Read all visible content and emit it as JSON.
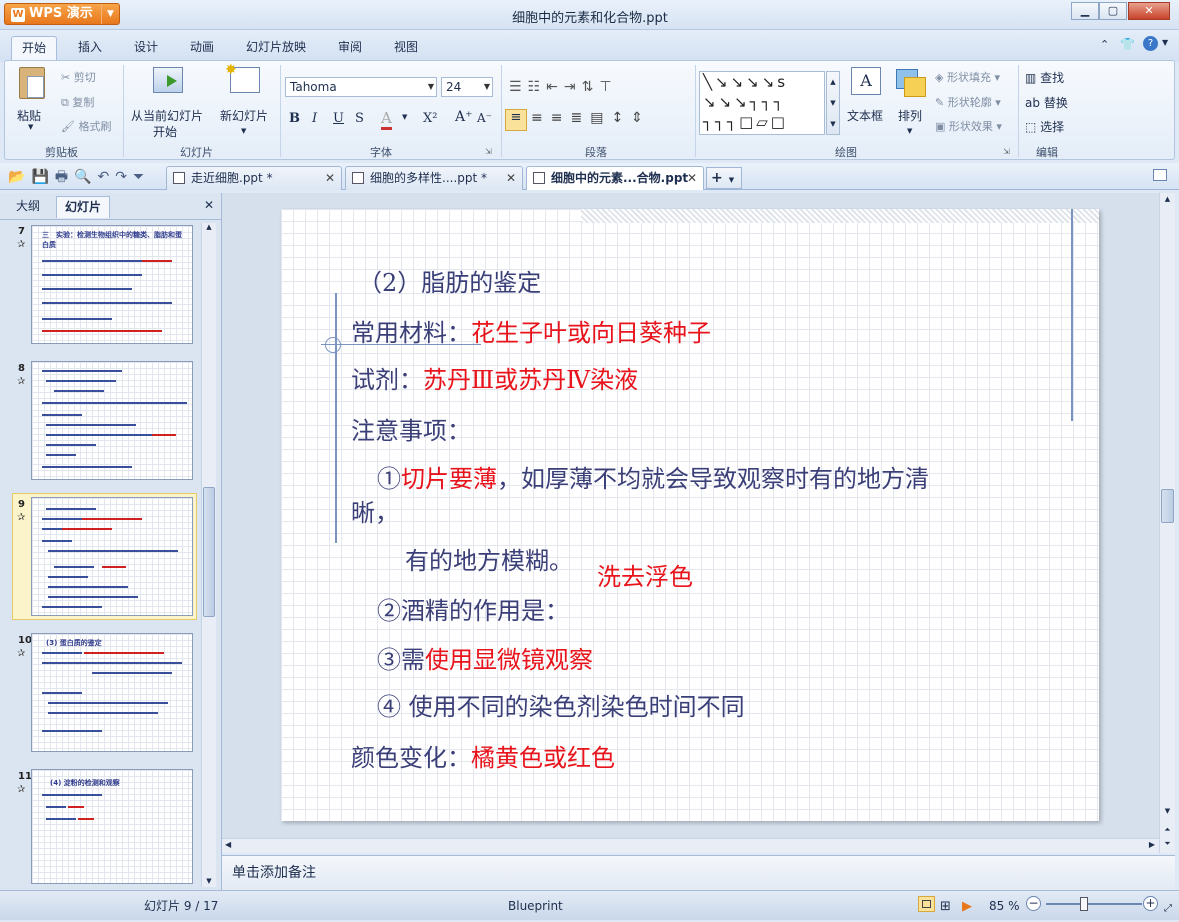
{
  "app": {
    "name": "WPS 演示",
    "window_title": "细胞中的元素和化合物.ppt"
  },
  "menu": {
    "tabs": [
      "开始",
      "插入",
      "设计",
      "动画",
      "幻灯片放映",
      "审阅",
      "视图"
    ],
    "active": "开始"
  },
  "ribbon": {
    "clipboard": {
      "paste": "粘贴",
      "cut": "剪切",
      "copy": "复制",
      "format_painter": "格式刷",
      "label": "剪贴板"
    },
    "slides": {
      "from_current": "从当前幻灯片",
      "start": "开始",
      "new_slide": "新幻灯片",
      "label": "幻灯片"
    },
    "font": {
      "name": "Tahoma",
      "size": "24",
      "label": "字体",
      "bold": "B",
      "italic": "I",
      "underline": "U",
      "shadow": "S",
      "color_a": "A",
      "superscript": "X²",
      "grow": "A⁺",
      "shrink": "A⁻"
    },
    "paragraph": {
      "label": "段落"
    },
    "drawing": {
      "textbox": "文本框",
      "arrange": "排列",
      "shape_fill": "形状填充",
      "shape_outline": "形状轮廓",
      "shape_effect": "形状效果",
      "label": "绘图"
    },
    "editing": {
      "find": "查找",
      "replace": "替换",
      "select": "选择",
      "label": "编辑"
    }
  },
  "doc_tabs": [
    {
      "label": "走近细胞.ppt *",
      "active": false
    },
    {
      "label": "细胞的多样性....ppt *",
      "active": false
    },
    {
      "label": "细胞中的元素...合物.ppt",
      "active": true
    }
  ],
  "left_panel": {
    "tabs": [
      "大纲",
      "幻灯片"
    ],
    "active": "幻灯片",
    "thumb_numbers": [
      "7",
      "8",
      "9",
      "10",
      "11"
    ],
    "selected": "9"
  },
  "slide": {
    "heading": "（2）脂肪的鉴定",
    "material_label": "常用材料：",
    "material_value": "花生子叶或向日葵种子",
    "reagent_label": "试剂：",
    "reagent_value": "苏丹Ⅲ或苏丹Ⅳ染液",
    "notes_title": "注意事项：",
    "item1_prefix": "①",
    "item1_red": "切片要薄",
    "item1_rest": "，如厚薄不均就会导致观察时有的地方清",
    "item1_wrap": "晰，",
    "item1_line2": "有的地方模糊。",
    "item2_answer": "洗去浮色",
    "item2": "②酒精的作用是：",
    "item3_prefix": "③需",
    "item3_red": "使用显微镜观察",
    "item4": "④ 使用不同的染色剂染色时间不同",
    "color_label": "颜色变化：",
    "color_value": "橘黄色或红色"
  },
  "thumbs": {
    "t7_title": "三　实验：检测生物组织中的糖类、脂肪和蛋白质",
    "t10_title": "(3) 蛋白质的鉴定",
    "t11_title": "(4) 淀粉的检测和观察"
  },
  "notes_placeholder": "单击添加备注",
  "status": {
    "slide_index": "幻灯片 9 / 17",
    "theme": "Blueprint",
    "zoom": "85 %"
  },
  "colors": {
    "accent": "#e8771c",
    "slide_text": "#3b3f78",
    "highlight": "#e8131b"
  }
}
